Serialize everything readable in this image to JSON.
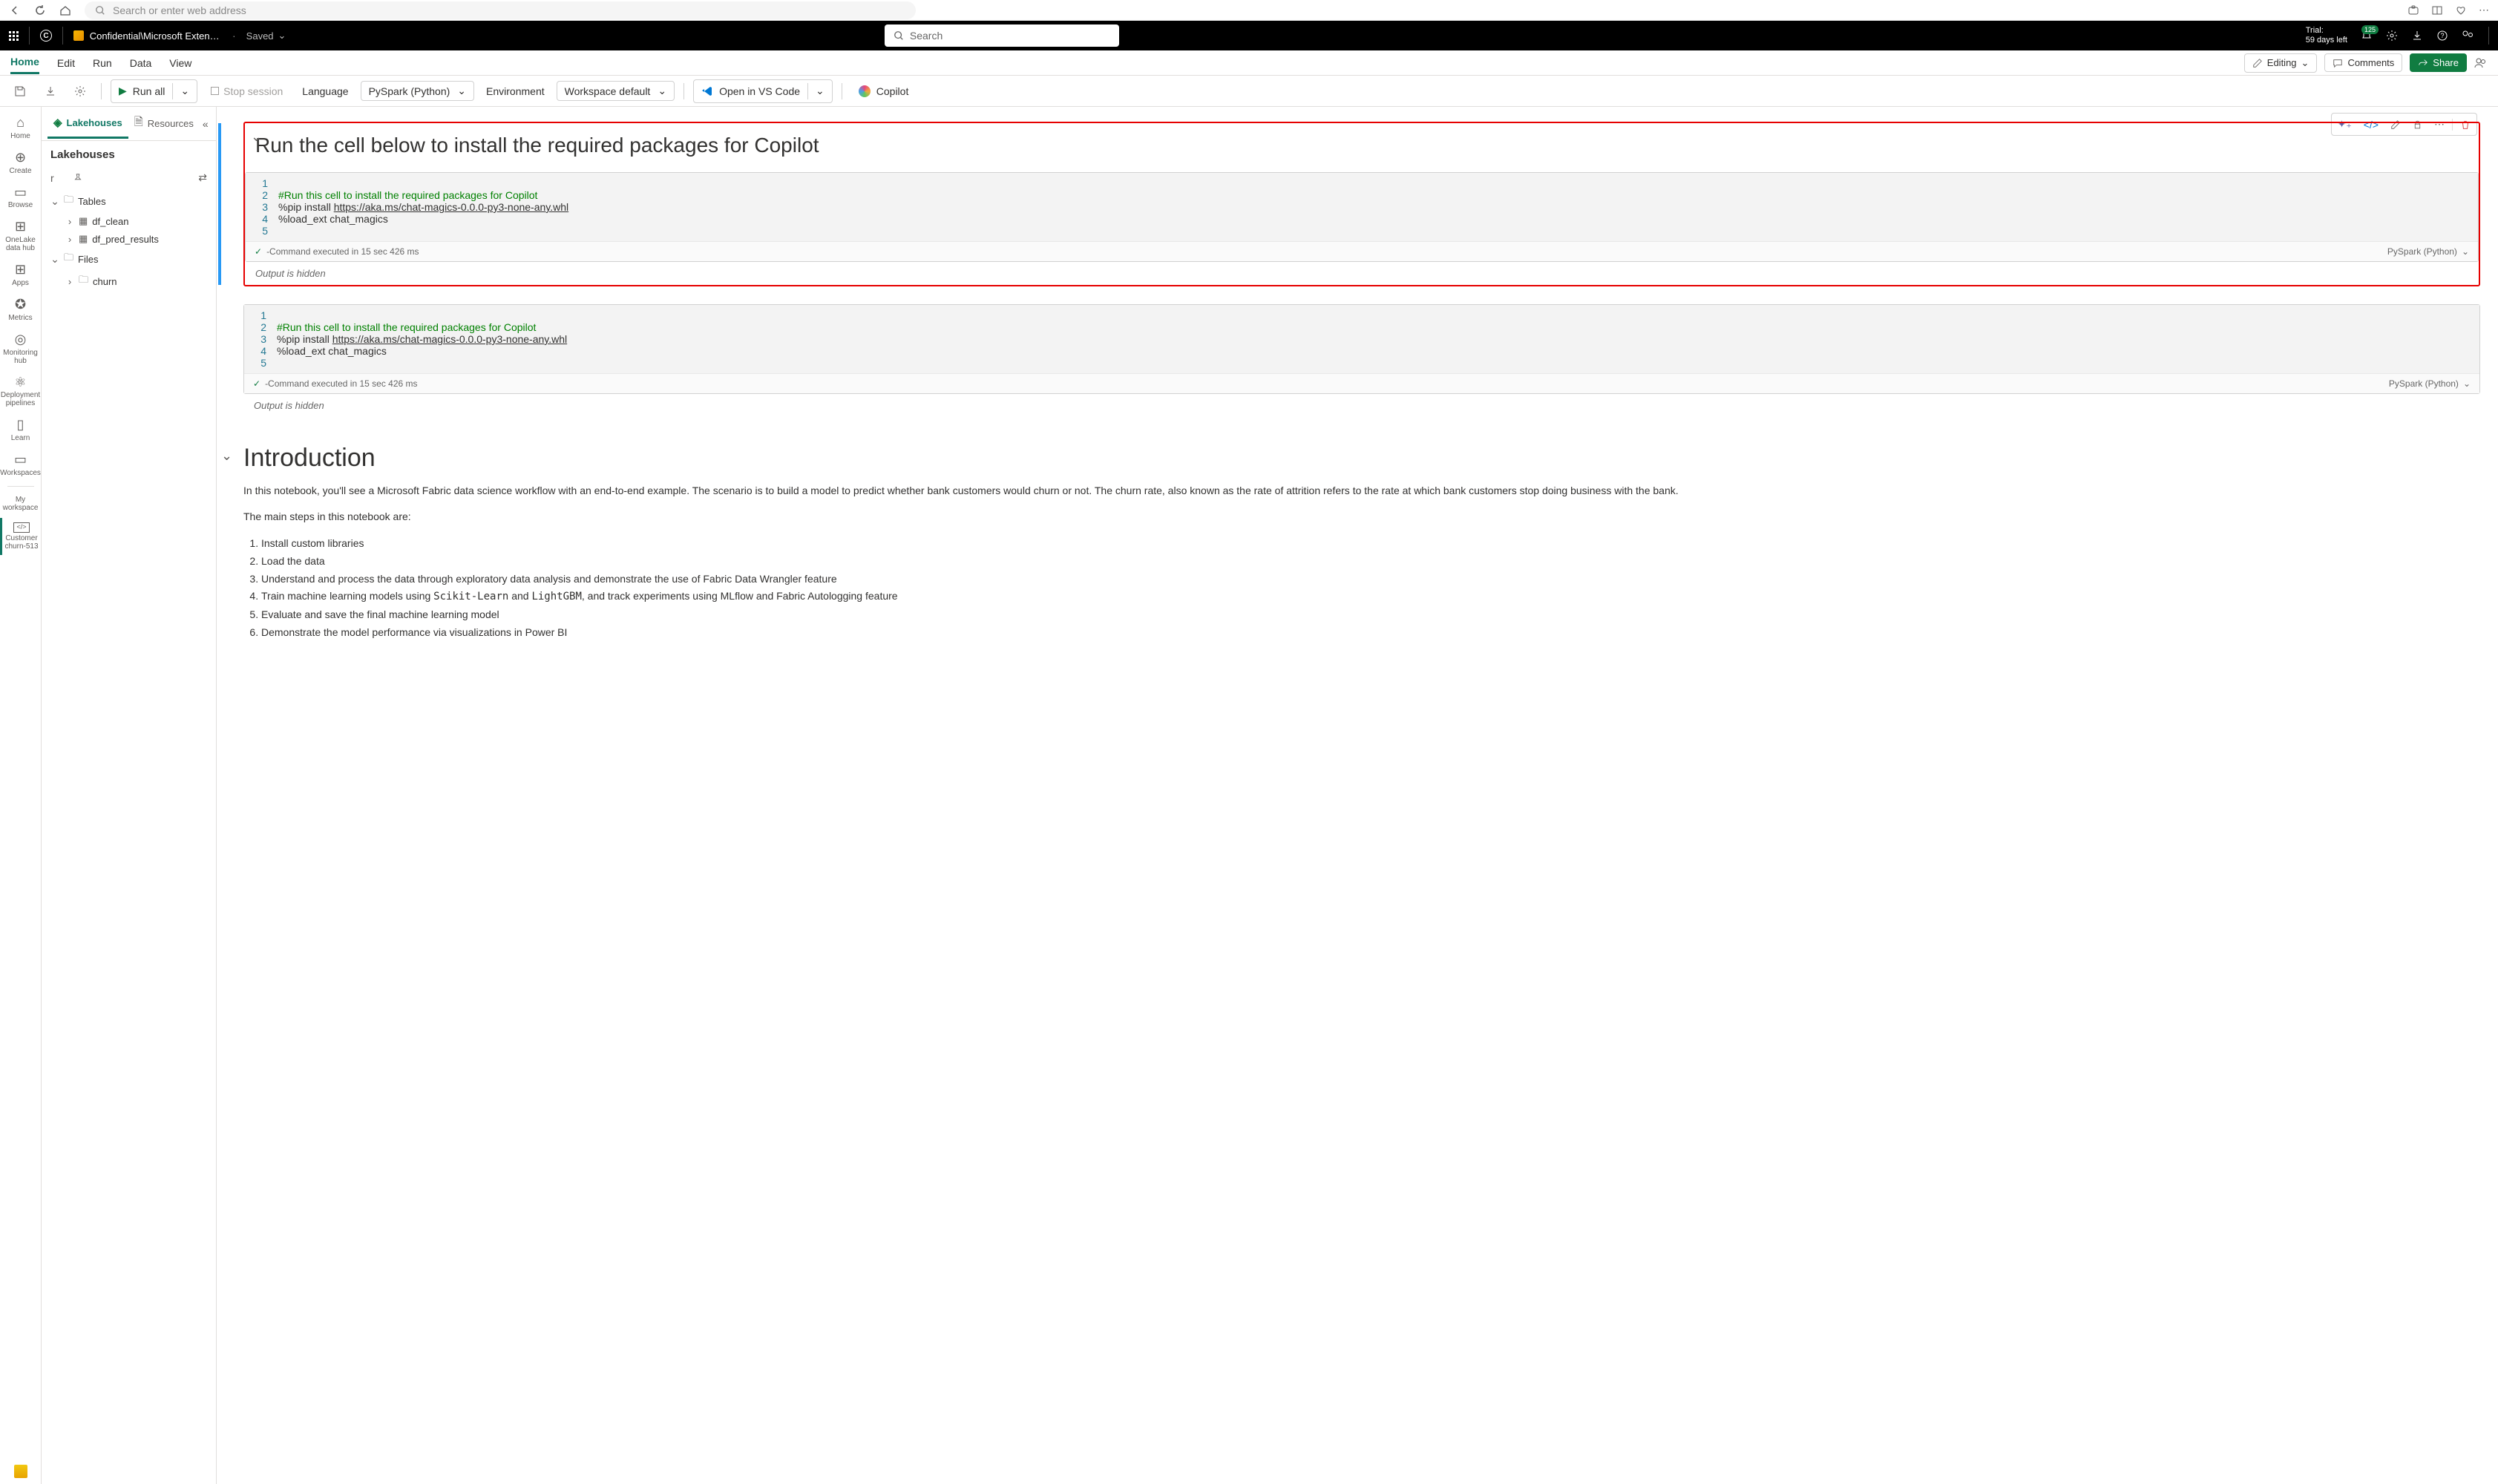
{
  "browser": {
    "search_placeholder": "Search or enter web address"
  },
  "topbar": {
    "circle_letter": "C",
    "breadcrumb": "Confidential\\Microsoft Extend…",
    "saved": "Saved",
    "search_placeholder": "Search",
    "trial_line1": "Trial:",
    "trial_line2": "59 days left",
    "notif_count": "125"
  },
  "ribbon": {
    "tabs": [
      "Home",
      "Edit",
      "Run",
      "Data",
      "View"
    ],
    "editing": "Editing",
    "comments": "Comments",
    "share": "Share"
  },
  "toolbar": {
    "run_all": "Run all",
    "stop": "Stop session",
    "language_label": "Language",
    "language_value": "PySpark (Python)",
    "env_label": "Environment",
    "env_value": "Workspace default",
    "vscode": "Open in VS Code",
    "copilot": "Copilot"
  },
  "rail": {
    "items": [
      {
        "label": "Home"
      },
      {
        "label": "Create"
      },
      {
        "label": "Browse"
      },
      {
        "label": "OneLake data hub"
      },
      {
        "label": "Apps"
      },
      {
        "label": "Metrics"
      },
      {
        "label": "Monitoring hub"
      },
      {
        "label": "Deployment pipelines"
      },
      {
        "label": "Learn"
      },
      {
        "label": "Workspaces"
      }
    ],
    "my_workspace": "My workspace",
    "active_item": "Customer churn-513"
  },
  "explorer": {
    "tabs": [
      "Lakehouses",
      "Resources"
    ],
    "header": "Lakehouses",
    "filter": "r",
    "tree": {
      "tables": "Tables",
      "t1": "df_clean",
      "t2": "df_pred_results",
      "files": "Files",
      "f1": "churn"
    }
  },
  "notebook": {
    "heading": "Run the cell below to install the required packages for Copilot",
    "code": {
      "l2": "#Run this cell to install the required packages for Copilot",
      "l3a": "%pip install ",
      "l3b": "https://aka.ms/chat-magics-0.0.0-py3-none-any.whl",
      "l4": "%load_ext chat_magics"
    },
    "exec_status": "-Command executed in 15 sec 426 ms",
    "cell_lang": "PySpark (Python)",
    "output_hidden": "Output is hidden",
    "intro": {
      "title": "Introduction",
      "p1": "In this notebook, you'll see a Microsoft Fabric data science workflow with an end-to-end example. The scenario is to build a model to predict whether bank customers would churn or not. The churn rate, also known as the rate of attrition refers to the rate at which bank customers stop doing business with the bank.",
      "p2": "The main steps in this notebook are:",
      "steps": [
        "Install custom libraries",
        "Load the data",
        "Understand and process the data through exploratory data analysis and demonstrate the use of Fabric Data Wrangler feature",
        "Train machine learning models using Scikit-Learn and LightGBM, and track experiments using MLflow and Fabric Autologging feature",
        "Evaluate and save the final machine learning model",
        "Demonstrate the model performance via visualizations in Power BI"
      ]
    }
  }
}
